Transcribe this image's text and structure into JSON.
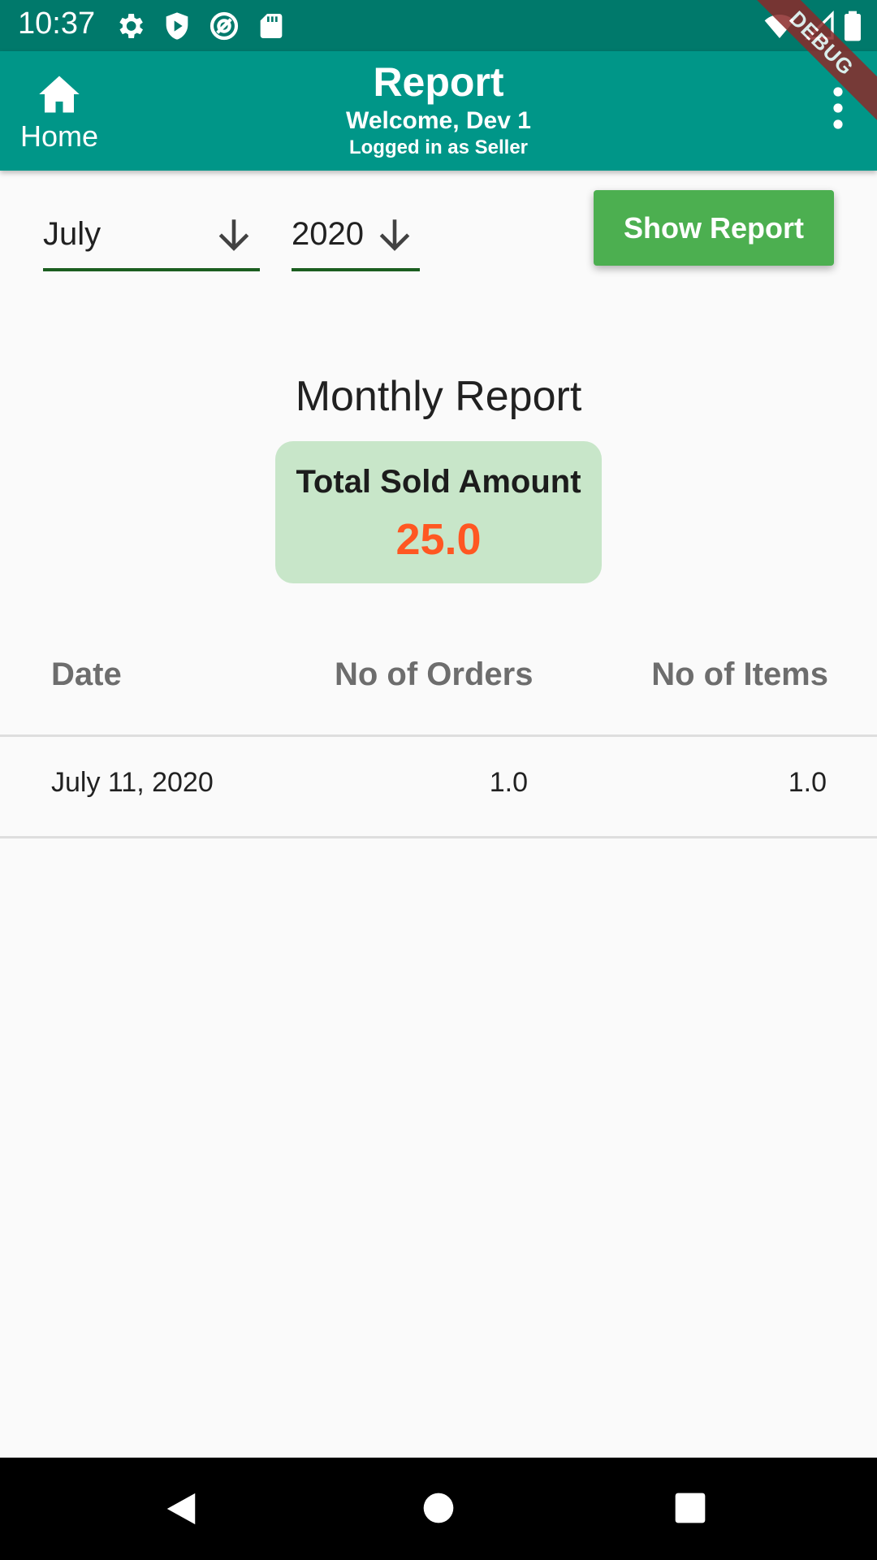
{
  "status_bar": {
    "time": "10:37",
    "icons": [
      "gear-icon",
      "shield-icon",
      "at-sign-icon",
      "sd-card-icon",
      "wifi-icon",
      "signal-icon",
      "battery-icon"
    ]
  },
  "app_bar": {
    "home_label": "Home",
    "title": "Report",
    "subtitle": "Welcome, Dev 1",
    "subsubtitle": "Logged in as Seller",
    "debug_label": "DEBUG",
    "color": "#009688"
  },
  "filters": {
    "month": "July",
    "year": "2020",
    "show_report_label": "Show Report"
  },
  "report": {
    "heading": "Monthly Report",
    "total_label": "Total Sold Amount",
    "total_value": "25.0",
    "total_color": "#ff5722"
  },
  "table": {
    "headers": [
      "Date",
      "No of Orders",
      "No of Items"
    ],
    "rows": [
      [
        "July 11, 2020",
        "1.0",
        "1.0"
      ]
    ]
  },
  "nav_bar": {
    "buttons": [
      "back-icon",
      "home-circle-icon",
      "recents-icon"
    ]
  }
}
